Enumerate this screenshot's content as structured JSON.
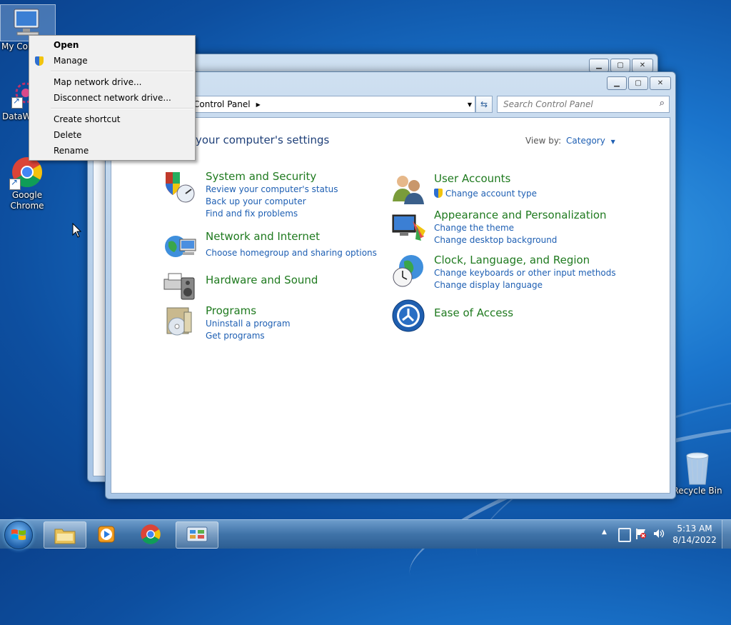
{
  "desktop": {
    "icons": [
      {
        "label": "My Computer"
      },
      {
        "label": "DataWatch"
      },
      {
        "label": "Google Chrome"
      },
      {
        "label": "Recycle Bin"
      }
    ]
  },
  "context_menu": {
    "items": {
      "open": "Open",
      "manage": "Manage",
      "map_drive": "Map network drive...",
      "disconnect_drive": "Disconnect network drive...",
      "create_shortcut": "Create shortcut",
      "delete": "Delete",
      "rename": "Rename"
    }
  },
  "control_panel": {
    "address": "Control Panel",
    "search_placeholder": "Search Control Panel",
    "heading": "your computer's settings",
    "view_by_label": "View by:",
    "view_by_value": "Category",
    "categories": {
      "system_security": {
        "title": "System and Security",
        "links": [
          "Review your computer's status",
          "Back up your computer",
          "Find and fix problems"
        ]
      },
      "network": {
        "title": "Network and Internet",
        "links": [
          "Choose homegroup and sharing options"
        ]
      },
      "hardware": {
        "title": "Hardware and Sound"
      },
      "programs": {
        "title": "Programs",
        "links": [
          "Uninstall a program",
          "Get programs"
        ]
      },
      "user_accounts": {
        "title": "User Accounts",
        "links": [
          "Change account type"
        ]
      },
      "appearance": {
        "title": "Appearance and Personalization",
        "links": [
          "Change the theme",
          "Change desktop background"
        ]
      },
      "clock": {
        "title": "Clock, Language, and Region",
        "links": [
          "Change keyboards or other input methods",
          "Change display language"
        ]
      },
      "ease": {
        "title": "Ease of Access"
      }
    }
  },
  "taskbar": {
    "time": "5:13 AM",
    "date": "8/14/2022"
  }
}
